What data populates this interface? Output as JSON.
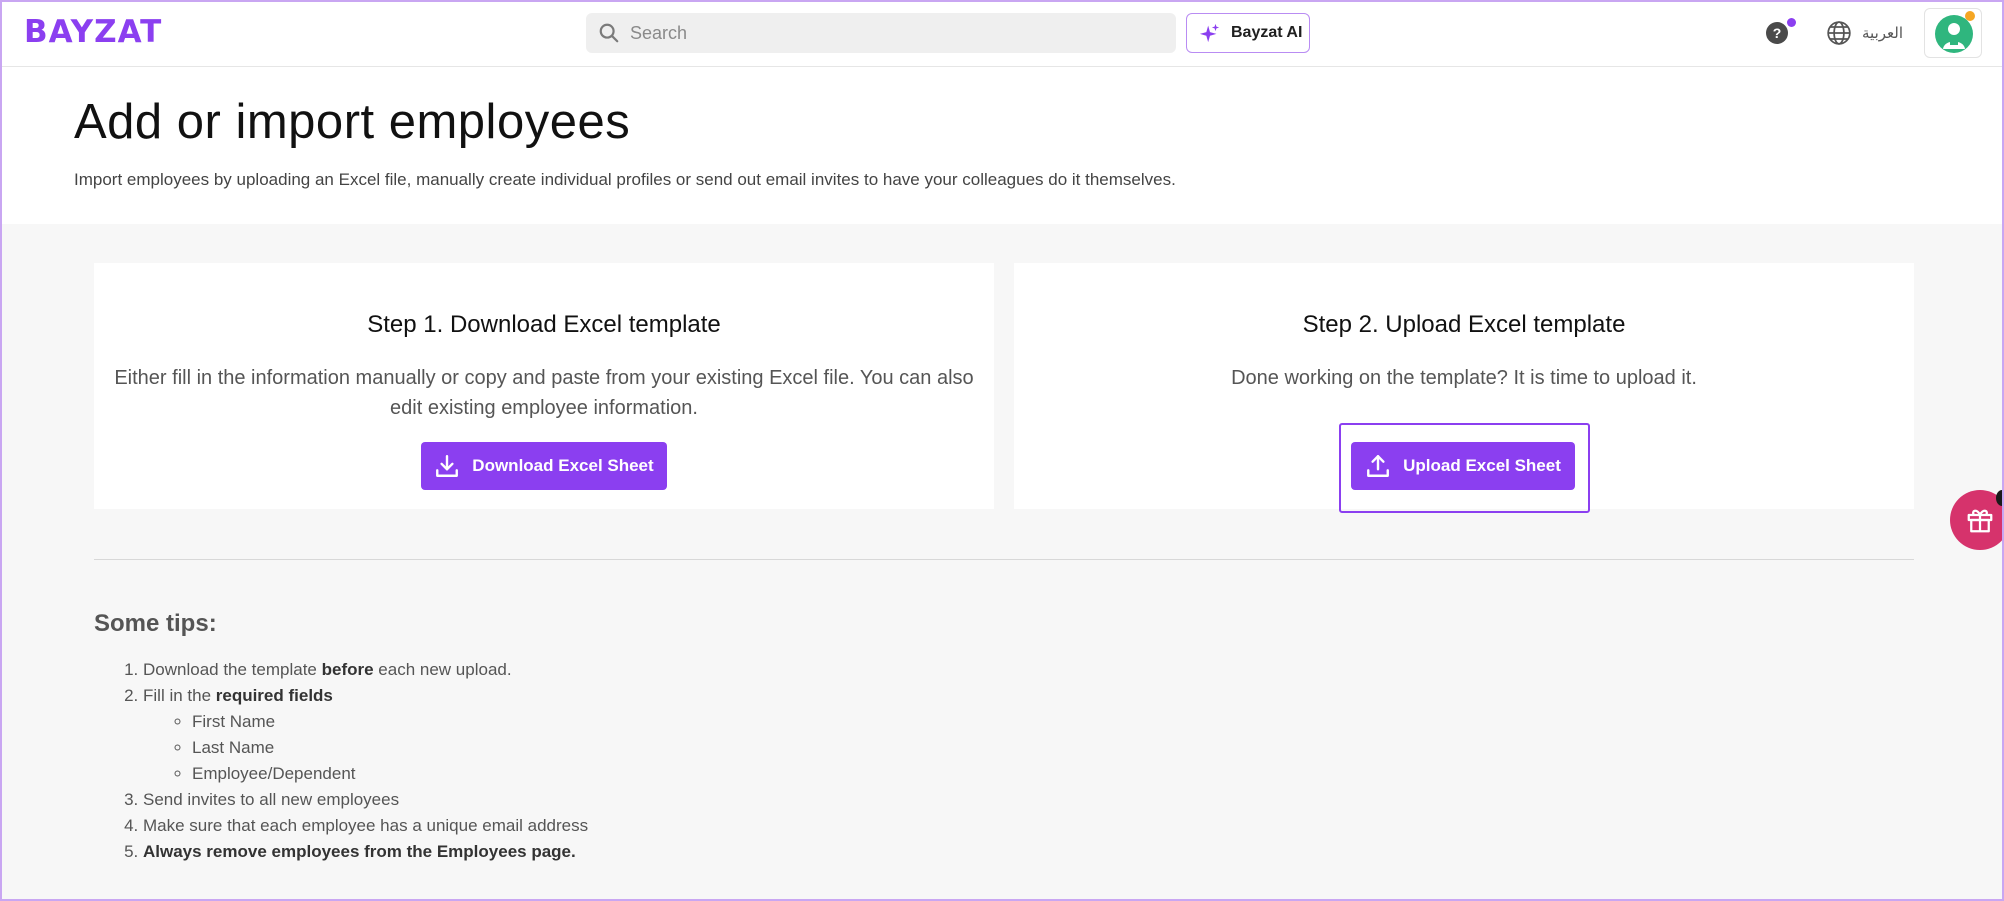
{
  "header": {
    "logo": "BAYZAT",
    "search_placeholder": "Search",
    "ai_button": "Bayzat AI",
    "help_symbol": "?",
    "language": "العربية"
  },
  "page": {
    "title": "Add or import employees",
    "subtitle": "Import employees by uploading an Excel file, manually create individual profiles or send out email invites to have your colleagues do it themselves."
  },
  "step1": {
    "title": "Step 1. Download Excel template",
    "description": "Either fill in the information manually or copy and paste from your existing Excel file. You can also edit existing employee information.",
    "button": "Download Excel Sheet"
  },
  "step2": {
    "title": "Step 2. Upload Excel template",
    "description": "Done working on the template? It is time to upload it.",
    "button": "Upload Excel Sheet"
  },
  "tips": {
    "title": "Some tips:",
    "item1_pre": "Download the template ",
    "item1_bold": "before",
    "item1_post": " each new upload.",
    "item2_pre": "Fill in the ",
    "item2_bold": "required fields",
    "fields": [
      "First Name",
      "Last Name",
      "Employee/Dependent"
    ],
    "item3": "Send invites to all new employees",
    "item4": "Make sure that each employee has a unique email address",
    "item5": "Always remove employees from the Employees page."
  },
  "colors": {
    "brand": "#8b3ff0",
    "gift": "#d6336c",
    "avatar": "#2fb67e"
  },
  "icons": [
    "search-icon",
    "sparkle-icon",
    "help-icon",
    "globe-icon",
    "avatar-icon",
    "download-icon",
    "upload-icon",
    "gift-icon"
  ]
}
